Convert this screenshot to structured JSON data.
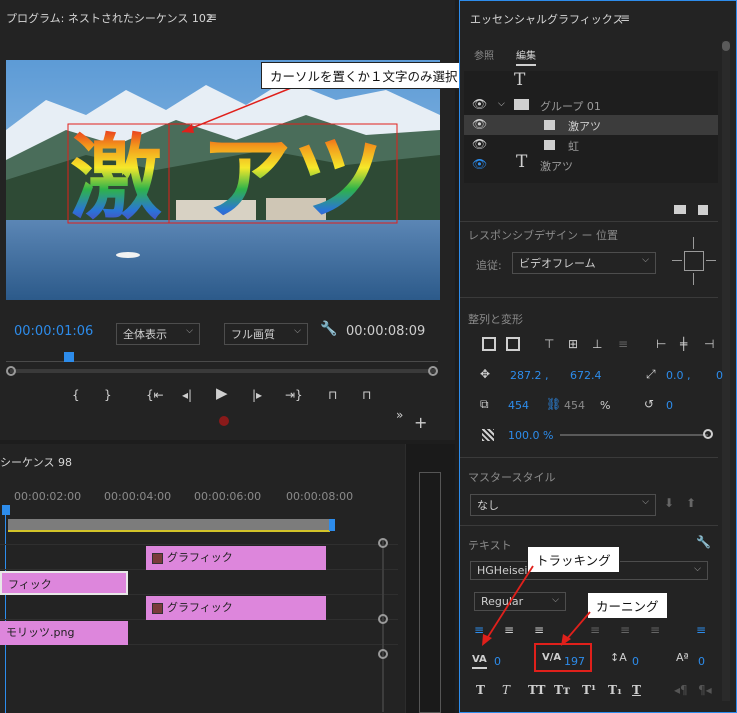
{
  "program": {
    "title": "プログラム: ネストされたシーケンス 102",
    "timecode_current": "00:00:01:06",
    "zoom": "全体表示",
    "quality": "フル画質",
    "timecode_duration": "00:00:08:09",
    "overlay_kanji": "激",
    "overlay_kana": "アツ"
  },
  "timeline": {
    "title": "シーケンス 98",
    "ruler": [
      "00:00:02:00",
      "00:00:04:00",
      "00:00:06:00",
      "00:00:08:00"
    ],
    "clips": [
      {
        "label": "グラフィック"
      },
      {
        "label": "フィック"
      },
      {
        "label": "グラフィック"
      },
      {
        "label": "モリッツ.png"
      }
    ]
  },
  "essential": {
    "title": "エッセンシャルグラフィックス",
    "tabs": [
      "参照",
      "編集"
    ],
    "layers": [
      {
        "label": "グループ 01"
      },
      {
        "label": "激アツ"
      },
      {
        "label": "虹"
      },
      {
        "label": "激アツ"
      }
    ],
    "responsive_title": "レスポンシブデザイン ー 位置",
    "follow_label": "追従:",
    "follow_value": "ビデオフレーム",
    "align_title": "整列と変形",
    "pos_x": "287.2 ,",
    "pos_y": "672.4",
    "anchor_x": "0.0 ,",
    "anchor_y": "0",
    "scale_w": "454",
    "scale_h": "454",
    "scale_unit": "%",
    "rotation": "0",
    "opacity": "100.0 %",
    "master_title": "マスタースタイル",
    "master_value": "なし",
    "text_title": "テキスト",
    "font_name": "HGHeisei",
    "font_style": "Regular",
    "tracking_value": "0",
    "kerning_value": "197",
    "leading_value": "0",
    "baseline_value": "0",
    "style_buttons": [
      "T",
      "T",
      "TT",
      "Tт",
      "T¹",
      "T₁",
      "T"
    ]
  },
  "callouts": {
    "cursor": "カーソルを置くか１文字のみ選択",
    "tracking": "トラッキング",
    "kerning": "カーニング"
  }
}
